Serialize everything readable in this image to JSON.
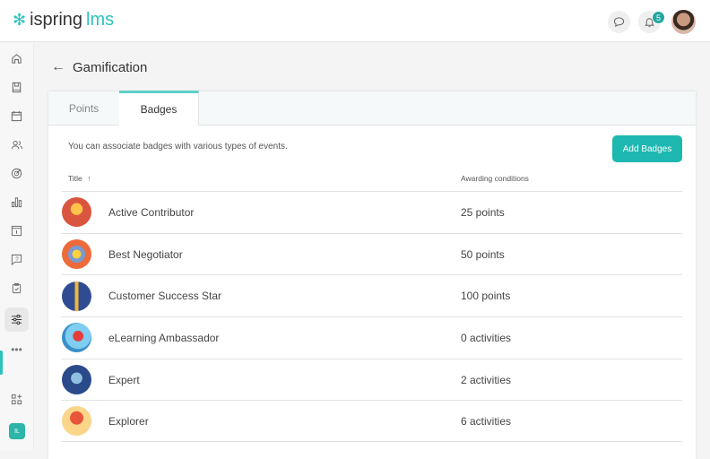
{
  "app": {
    "logo_main": "ispring",
    "logo_accent": "lms",
    "notifications_count": "5",
    "user_initials": "IL"
  },
  "page": {
    "title": "Gamification"
  },
  "tabs": [
    {
      "label": "Points"
    },
    {
      "label": "Badges"
    }
  ],
  "description": "You can associate badges with various types of events.",
  "add_button": "Add Badges",
  "columns": {
    "title": "Title",
    "sort_icon": "↑",
    "conditions": "Awarding conditions"
  },
  "badges": [
    {
      "name": "Active Contributor",
      "condition": "25 points",
      "color": "#d9553f"
    },
    {
      "name": "Best Negotiator",
      "condition": "50 points",
      "color": "#ee6a3a"
    },
    {
      "name": "Customer Success Star",
      "condition": "100 points",
      "color": "#2f4c93"
    },
    {
      "name": "eLearning Ambassador",
      "condition": "0 activities",
      "color": "#5ab8e0"
    },
    {
      "name": "Expert",
      "condition": "2 activities",
      "color": "#2a4a8a"
    },
    {
      "name": "Explorer",
      "condition": "6 activities",
      "color": "#f8c060"
    }
  ]
}
